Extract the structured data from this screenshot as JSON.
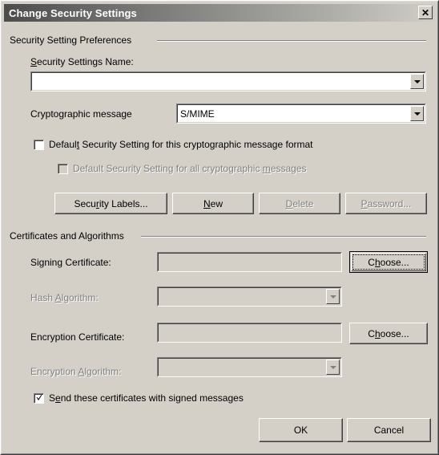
{
  "window": {
    "title": "Change Security Settings",
    "close_label": "✕"
  },
  "groups": {
    "preferences": "Security Setting Preferences",
    "certificates": "Certificates and Algorithms"
  },
  "fields": {
    "settings_name": {
      "label_pre": "S",
      "label_key": "S",
      "label_rest": "ecurity Settings Name:",
      "label_full": "Security Settings Name:",
      "value": "",
      "placeholder": ""
    },
    "crypto_message": {
      "label": "Cryptographic message",
      "value": "S/MIME"
    },
    "signing_certificate": {
      "label": "Signing Certificate:",
      "value": ""
    },
    "hash_algorithm": {
      "label_pre": "Hash ",
      "label_key": "A",
      "label_rest": "lgorithm:",
      "value": ""
    },
    "encryption_certificate": {
      "label": "Encryption Certificate:",
      "value": ""
    },
    "encryption_algorithm": {
      "label_pre": "Encryption ",
      "label_key": "A",
      "label_rest": "lgorithm:",
      "value": ""
    }
  },
  "checkboxes": {
    "default_this_format": {
      "pre": "Defaul",
      "key": "t",
      "rest": " Security Setting for this cryptographic message format",
      "checked": false,
      "enabled": true
    },
    "default_all_messages": {
      "pre": "Default Security Setting for all cryptographic ",
      "key": "m",
      "rest": "essages",
      "checked": false,
      "enabled": false
    },
    "send_certificates": {
      "pre": "S",
      "key": "e",
      "rest": "nd these certificates with signed messages",
      "checked": true,
      "enabled": true
    }
  },
  "buttons": {
    "security_labels": {
      "pre": "Secu",
      "key": "r",
      "rest": "ity Labels...",
      "enabled": true
    },
    "new": {
      "pre": "",
      "key": "N",
      "rest": "ew",
      "enabled": true
    },
    "delete": {
      "pre": "",
      "key": "D",
      "rest": "elete",
      "enabled": false
    },
    "password": {
      "pre": "",
      "key": "P",
      "rest": "assword...",
      "enabled": false
    },
    "choose_signing": {
      "pre": "C",
      "key": "h",
      "rest": "oose...",
      "enabled": true,
      "focused": true
    },
    "choose_encryption": {
      "pre": "C",
      "key": "h",
      "rest": "oose...",
      "enabled": true,
      "focused": false
    },
    "ok": {
      "label": "OK",
      "enabled": true
    },
    "cancel": {
      "label": "Cancel",
      "enabled": true
    }
  },
  "colors": {
    "dialog_face": "#d4d0c8",
    "title_start": "#4c4c4c",
    "title_end": "#cfcdc6",
    "text": "#000000",
    "disabled_text": "#808080",
    "field_bg": "#ffffff"
  }
}
